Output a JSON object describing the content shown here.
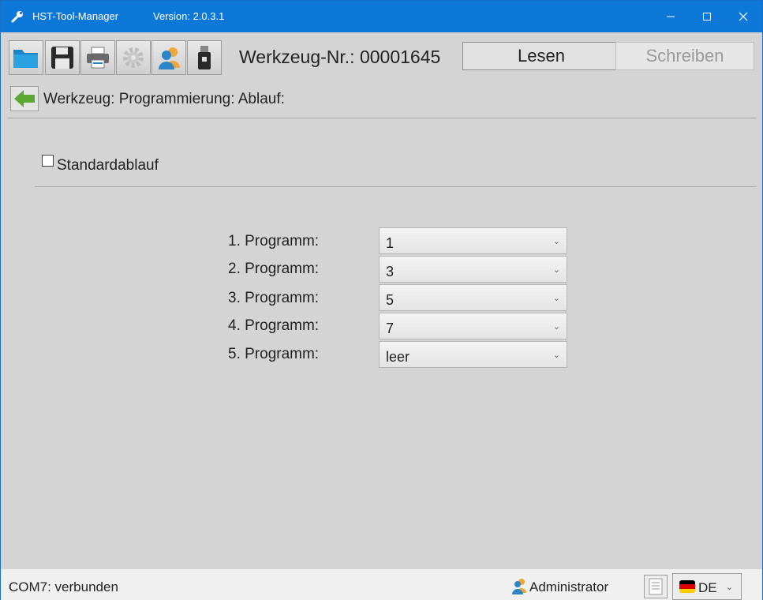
{
  "window": {
    "title": "HST-Tool-Manager",
    "version": "Version: 2.0.3.1",
    "controls": {
      "minimize": "—",
      "maximize": "☐",
      "close": "✕"
    }
  },
  "toolbar": {
    "icons": [
      "folder-icon",
      "save-icon",
      "printer-icon",
      "gear-icon",
      "user-icon",
      "usb-icon"
    ],
    "tool_number": "Werkzeug-Nr.: 00001645",
    "read_label": "Lesen",
    "write_label": "Schreiben"
  },
  "nav": {
    "breadcrumb": "Werkzeug: Programmierung: Ablauf:"
  },
  "form": {
    "standard_checkbox_label": "Standardablauf",
    "standard_checked": false,
    "programs": [
      {
        "label": "1. Programm:",
        "value": "1"
      },
      {
        "label": "2. Programm:",
        "value": "3"
      },
      {
        "label": "3. Programm:",
        "value": "5"
      },
      {
        "label": "4. Programm:",
        "value": "7"
      },
      {
        "label": "5. Programm:",
        "value": "leer"
      }
    ]
  },
  "status": {
    "connection": "COM7: verbunden",
    "user": "Administrator",
    "language": "DE"
  },
  "colors": {
    "titlebar": "#0d78d8",
    "background": "#d4d4d4",
    "statusbar": "#f0f0f0"
  }
}
